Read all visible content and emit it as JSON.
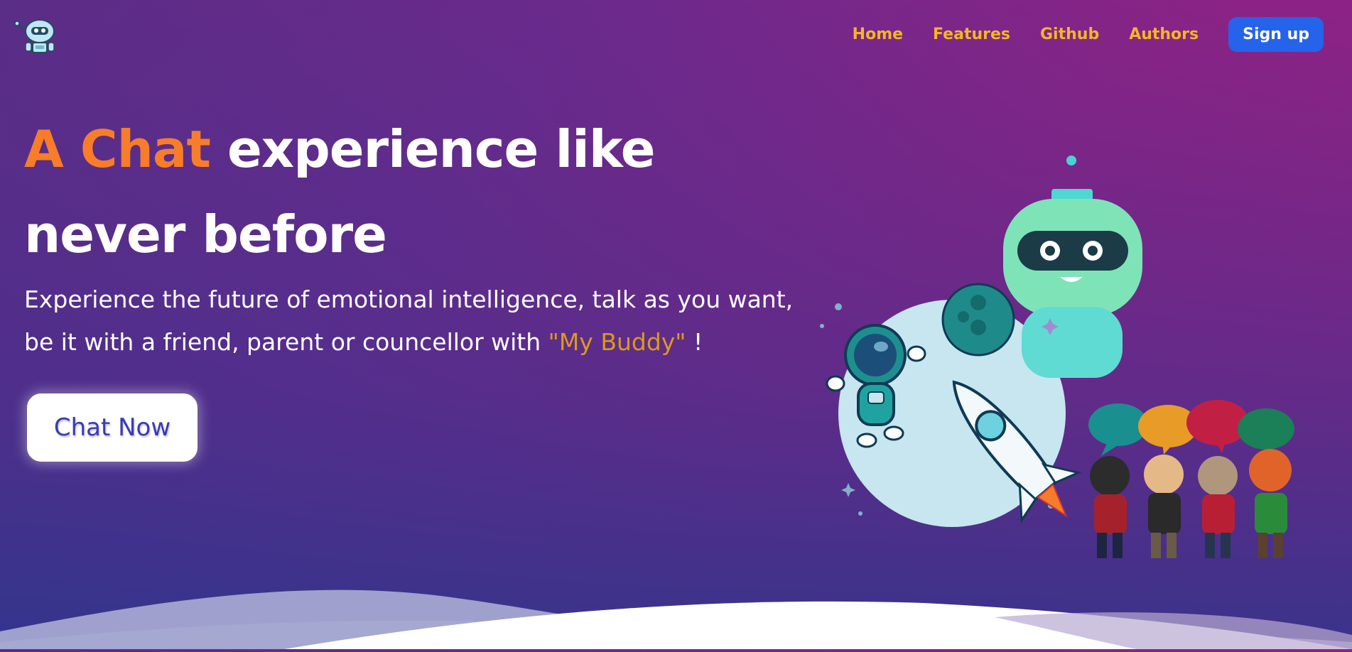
{
  "nav": {
    "logo_icon": "robot-icon",
    "links": [
      "Home",
      "Features",
      "Github",
      "Authors"
    ],
    "signup_label": "Sign up"
  },
  "hero": {
    "headline_accent": "A Chat",
    "headline_rest": " experience like never before",
    "subtext_main": "Experience the future of emotional intelligence, talk as you want, be it with a friend, parent or councellor with ",
    "subtext_highlight": "\"My Buddy\"",
    "subtext_end": " !",
    "cta_label": "Chat Now"
  },
  "colors": {
    "accent_orange": "#f77d2a",
    "nav_link_gold": "#f5b525",
    "signup_blue": "#2563eb",
    "buddy_gold": "#d99a1c"
  },
  "illustration": {
    "icons": [
      "robot-icon",
      "astronaut-icon",
      "planet-icon",
      "rocket-icon",
      "speech-bubbles-icon",
      "people-figures-icon"
    ]
  }
}
